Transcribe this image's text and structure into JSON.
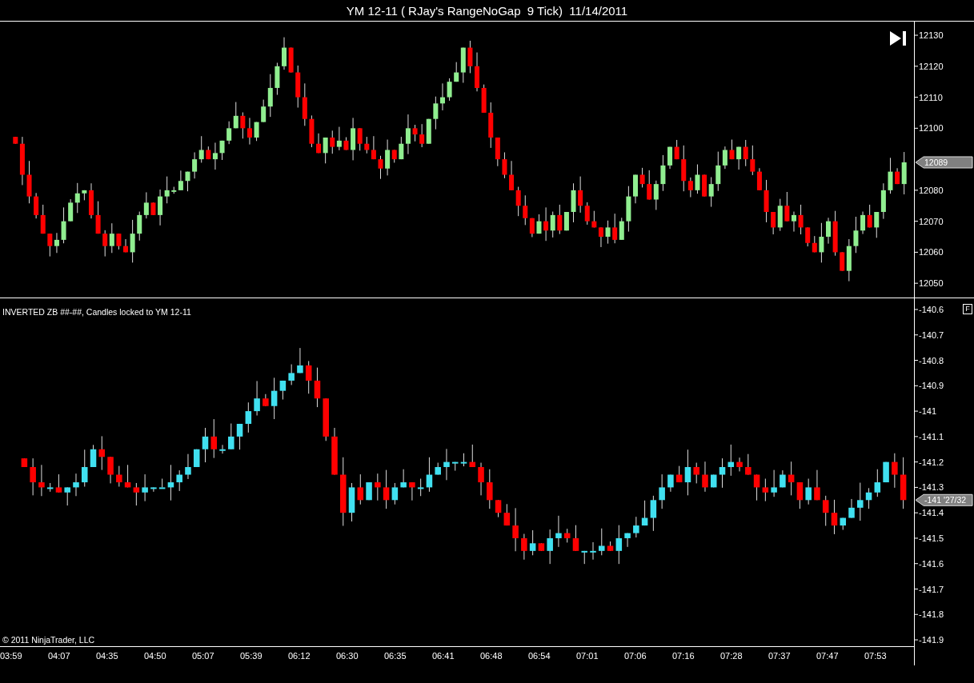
{
  "window": {
    "title": "YM 12-11 ( RJay's RangeNoGap  9 Tick)  11/14/2011"
  },
  "panes": [
    {
      "price_tag": "12089",
      "y_axis": [
        "12130",
        "12120",
        "12110",
        "12100",
        "12080",
        "12070",
        "12060",
        "12050"
      ]
    },
    {
      "label": "INVERTED ZB ##-##, Candles locked to YM 12-11",
      "price_tag": "-141 '27/32",
      "f_button": "F",
      "y_axis": [
        "-140.6",
        "-140.7",
        "-140.8",
        "-140.9",
        "-141",
        "-141.1",
        "-141.2",
        "-141.3",
        "-141.4",
        "-141.5",
        "-141.6",
        "-141.7",
        "-141.8",
        "-141.9"
      ]
    }
  ],
  "copyright": "© 2011 NinjaTrader, LLC",
  "time_axis": [
    "03:59",
    "04:07",
    "04:35",
    "04:50",
    "05:07",
    "05:39",
    "06:12",
    "06:30",
    "06:35",
    "06:41",
    "06:48",
    "06:54",
    "07:01",
    "07:06",
    "07:16",
    "07:28",
    "07:37",
    "07:47",
    "07:53"
  ]
}
